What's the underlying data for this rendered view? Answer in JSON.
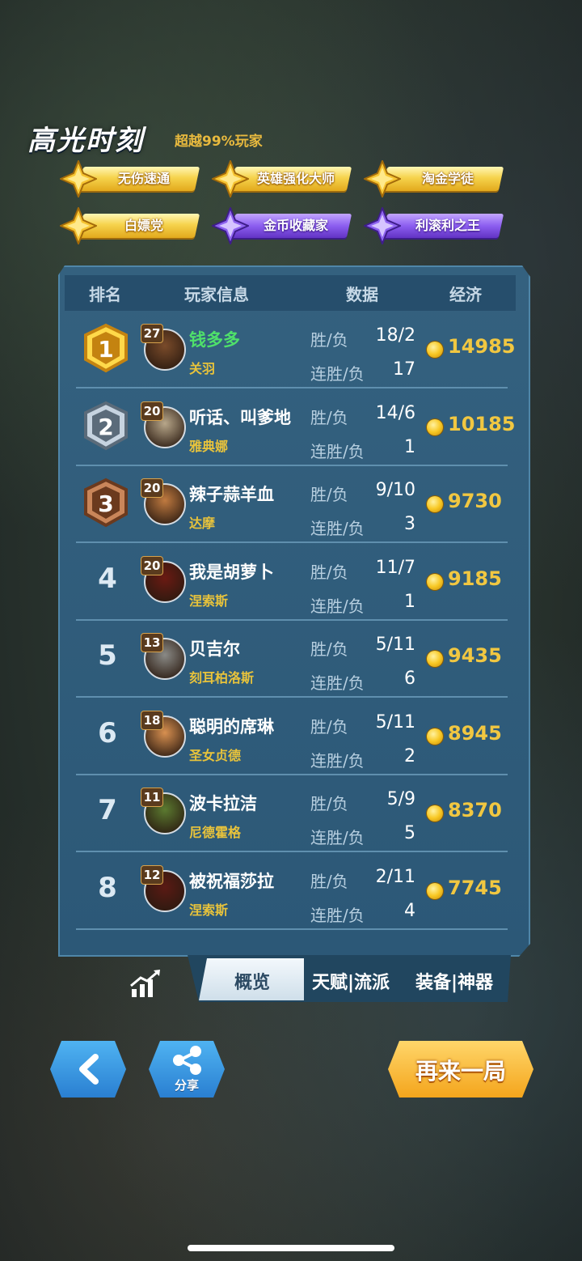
{
  "highlights": {
    "title": "高光时刻",
    "subtitle": "超越99%玩家",
    "badges": [
      {
        "label": "无伤速通",
        "tier": "gold"
      },
      {
        "label": "英雄强化大师",
        "tier": "gold"
      },
      {
        "label": "淘金学徒",
        "tier": "gold"
      },
      {
        "label": "白嫖党",
        "tier": "gold"
      },
      {
        "label": "金币收藏家",
        "tier": "purple"
      },
      {
        "label": "利滚利之王",
        "tier": "purple"
      }
    ]
  },
  "table": {
    "headers": {
      "rank": "排名",
      "player": "玩家信息",
      "data": "数据",
      "economy": "经济"
    },
    "win_loss_label": "胜/负",
    "streak_label": "连胜/负",
    "rows": [
      {
        "rank": "1",
        "level": "27",
        "name": "钱多多",
        "hero": "关羽",
        "win_loss": "18/2",
        "streak": "17",
        "economy": "14985",
        "is_self": true
      },
      {
        "rank": "2",
        "level": "20",
        "name": "听话、叫爹地",
        "hero": "雅典娜",
        "win_loss": "14/6",
        "streak": "1",
        "economy": "10185",
        "is_self": false
      },
      {
        "rank": "3",
        "level": "20",
        "name": "辣子蒜羊血",
        "hero": "达摩",
        "win_loss": "9/10",
        "streak": "3",
        "economy": "9730",
        "is_self": false
      },
      {
        "rank": "4",
        "level": "20",
        "name": "我是胡萝卜",
        "hero": "涅索斯",
        "win_loss": "11/7",
        "streak": "1",
        "economy": "9185",
        "is_self": false
      },
      {
        "rank": "5",
        "level": "13",
        "name": "贝吉尔",
        "hero": "刻耳柏洛斯",
        "win_loss": "5/11",
        "streak": "6",
        "economy": "9435",
        "is_self": false
      },
      {
        "rank": "6",
        "level": "18",
        "name": "聪明的席琳",
        "hero": "圣女贞德",
        "win_loss": "5/11",
        "streak": "2",
        "economy": "8945",
        "is_self": false
      },
      {
        "rank": "7",
        "level": "11",
        "name": "波卡拉洁",
        "hero": "尼德霍格",
        "win_loss": "5/9",
        "streak": "5",
        "economy": "8370",
        "is_self": false
      },
      {
        "rank": "8",
        "level": "12",
        "name": "被祝福莎拉",
        "hero": "涅索斯",
        "win_loss": "2/11",
        "streak": "4",
        "economy": "7745",
        "is_self": false
      }
    ]
  },
  "tabs": {
    "overview": "概览",
    "talent": "天赋|流派",
    "equipment": "装备|神器"
  },
  "buttons": {
    "share": "分享",
    "replay": "再来一局"
  },
  "colors": {
    "accent_gold": "#f1c741",
    "self_name": "#4fe06a",
    "panel": "#2c5877"
  }
}
